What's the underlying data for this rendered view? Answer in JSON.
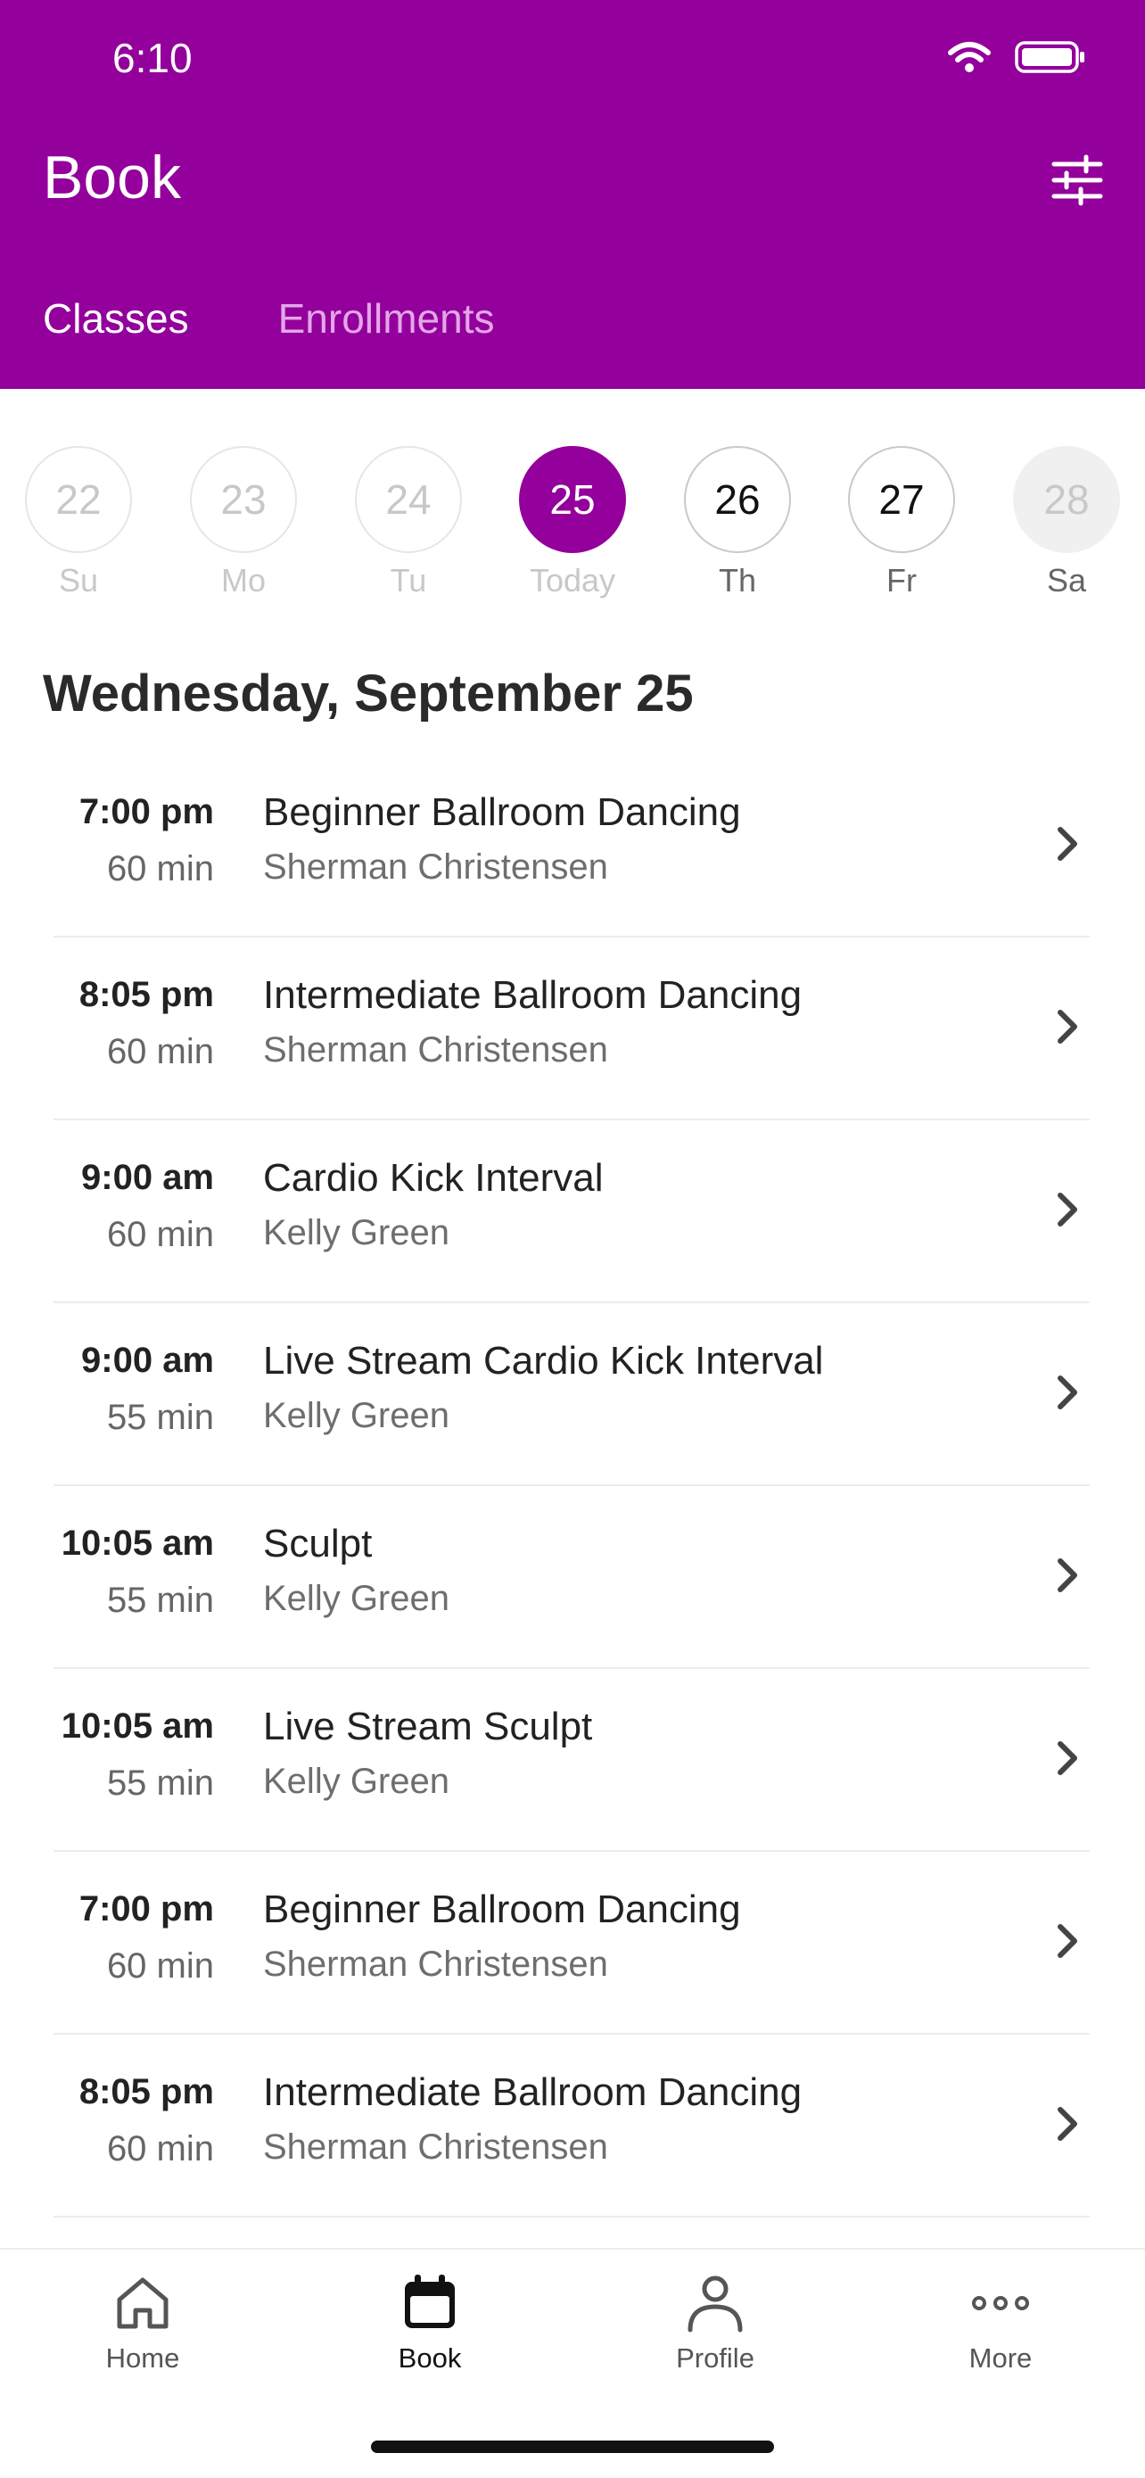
{
  "status_bar": {
    "time": "6:10"
  },
  "header": {
    "title": "Book",
    "filter_icon": "sliders-icon",
    "tabs": [
      {
        "label": "Classes",
        "active": true
      },
      {
        "label": "Enrollments",
        "active": false
      }
    ]
  },
  "colors": {
    "brand": "#93009b",
    "tab_inactive": "#e4a6e8"
  },
  "date_strip": [
    {
      "day": "22",
      "label": "Su",
      "state": "past"
    },
    {
      "day": "23",
      "label": "Mo",
      "state": "past"
    },
    {
      "day": "24",
      "label": "Tu",
      "state": "past"
    },
    {
      "day": "25",
      "label": "Today",
      "state": "selected"
    },
    {
      "day": "26",
      "label": "Th",
      "state": "upcoming"
    },
    {
      "day": "27",
      "label": "Fr",
      "state": "upcoming"
    },
    {
      "day": "28",
      "label": "Sa",
      "state": "disabled"
    }
  ],
  "day_heading": "Wednesday, September 25",
  "classes": [
    {
      "time": "7:00 pm",
      "duration": "60 min",
      "title": "Beginner Ballroom Dancing",
      "instructor": "Sherman Christensen"
    },
    {
      "time": "8:05 pm",
      "duration": "60 min",
      "title": "Intermediate Ballroom Dancing",
      "instructor": "Sherman Christensen"
    },
    {
      "time": "9:00 am",
      "duration": "60 min",
      "title": "Cardio Kick Interval",
      "instructor": "Kelly Green"
    },
    {
      "time": "9:00 am",
      "duration": "55 min",
      "title": "Live Stream Cardio Kick Interval",
      "instructor": "Kelly Green"
    },
    {
      "time": "10:05 am",
      "duration": "55 min",
      "title": "Sculpt",
      "instructor": "Kelly Green"
    },
    {
      "time": "10:05 am",
      "duration": "55 min",
      "title": "Live Stream Sculpt",
      "instructor": "Kelly Green"
    },
    {
      "time": "7:00 pm",
      "duration": "60 min",
      "title": "Beginner Ballroom Dancing",
      "instructor": "Sherman Christensen"
    },
    {
      "time": "8:05 pm",
      "duration": "60 min",
      "title": "Intermediate Ballroom Dancing",
      "instructor": "Sherman Christensen"
    }
  ],
  "bottom_nav": [
    {
      "label": "Home",
      "icon": "home-icon",
      "active": false
    },
    {
      "label": "Book",
      "icon": "calendar-icon",
      "active": true
    },
    {
      "label": "Profile",
      "icon": "person-icon",
      "active": false
    },
    {
      "label": "More",
      "icon": "more-icon",
      "active": false
    }
  ]
}
